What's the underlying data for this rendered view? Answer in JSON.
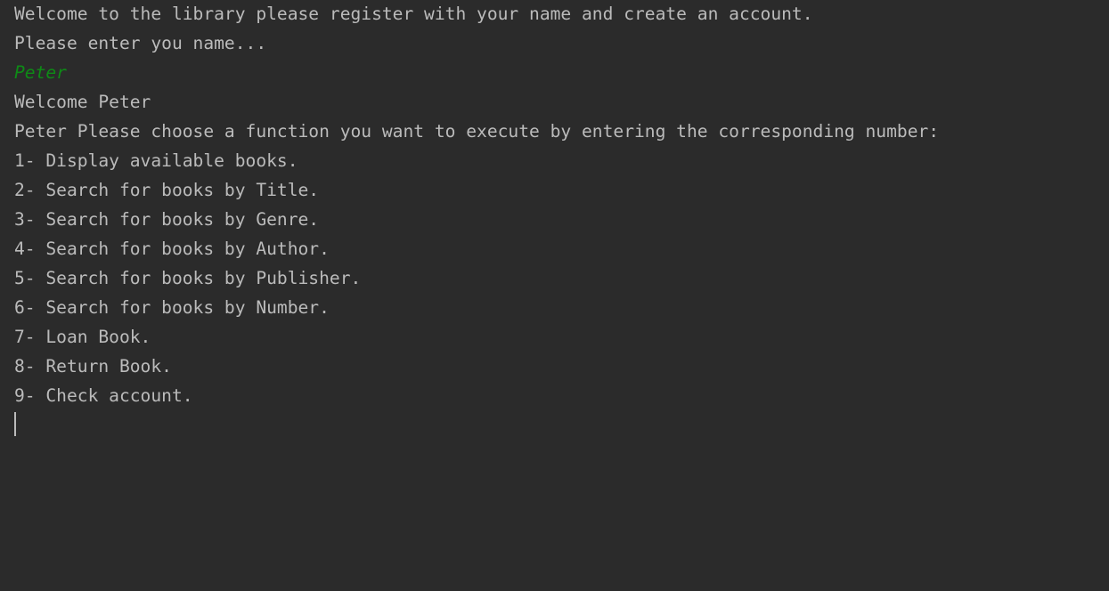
{
  "console": {
    "lines": [
      {
        "text": "Welcome to the library please register with your name and create an account.",
        "type": "output"
      },
      {
        "text": "Please enter you name...",
        "type": "output"
      },
      {
        "text": "Peter",
        "type": "input"
      },
      {
        "text": "Welcome Peter",
        "type": "output"
      },
      {
        "text": "Peter Please choose a function you want to execute by entering the corresponding number:",
        "type": "output"
      },
      {
        "text": "1- Display available books.",
        "type": "output"
      },
      {
        "text": "2- Search for books by Title.",
        "type": "output"
      },
      {
        "text": "3- Search for books by Genre.",
        "type": "output"
      },
      {
        "text": "4- Search for books by Author.",
        "type": "output"
      },
      {
        "text": "5- Search for books by Publisher.",
        "type": "output"
      },
      {
        "text": "6- Search for books by Number.",
        "type": "output"
      },
      {
        "text": "7- Loan Book.",
        "type": "output"
      },
      {
        "text": "8- Return Book.",
        "type": "output"
      },
      {
        "text": "9- Check account.",
        "type": "output"
      }
    ]
  },
  "colors": {
    "background": "#2b2b2b",
    "text": "#bbbbbb",
    "user_input": "#0e8a16"
  }
}
